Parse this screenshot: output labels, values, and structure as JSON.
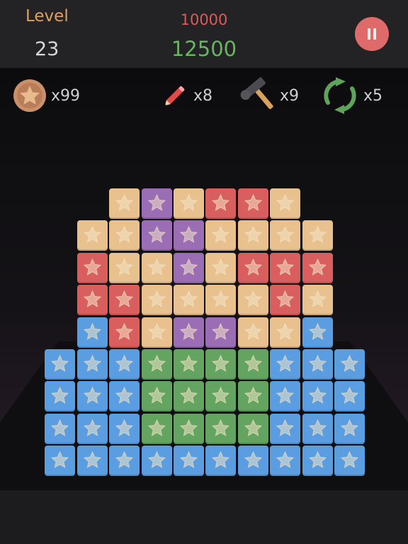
{
  "header": {
    "level_label": "Level",
    "level_value": "23",
    "target_score": "10000",
    "current_score": "12500"
  },
  "colors": {
    "yellow": "#e8c18f",
    "purple": "#9b6db5",
    "red": "#d95f5f",
    "blue": "#5a9de0",
    "green": "#62a460",
    "star_fill": "#f3e3c6",
    "pause": "#df6a6a"
  },
  "tools": [
    {
      "name": "coin-icon",
      "count": "x99"
    },
    {
      "name": "pencil-icon",
      "count": "x8"
    },
    {
      "name": "hammer-icon",
      "count": "x9"
    },
    {
      "name": "refresh-icon",
      "count": "x5"
    }
  ],
  "board": {
    "rows": [
      "...YPYRRY..",
      "..YYPPYYYY.",
      "..RYYPYRRR.",
      "..RRYYYYRY.",
      "..BRYPPYYB.",
      ".BBBGGGGBBB",
      ".BBBGGGGBBB",
      ".BBBGGGGBBB",
      ".BBBBBBBBBB"
    ]
  }
}
